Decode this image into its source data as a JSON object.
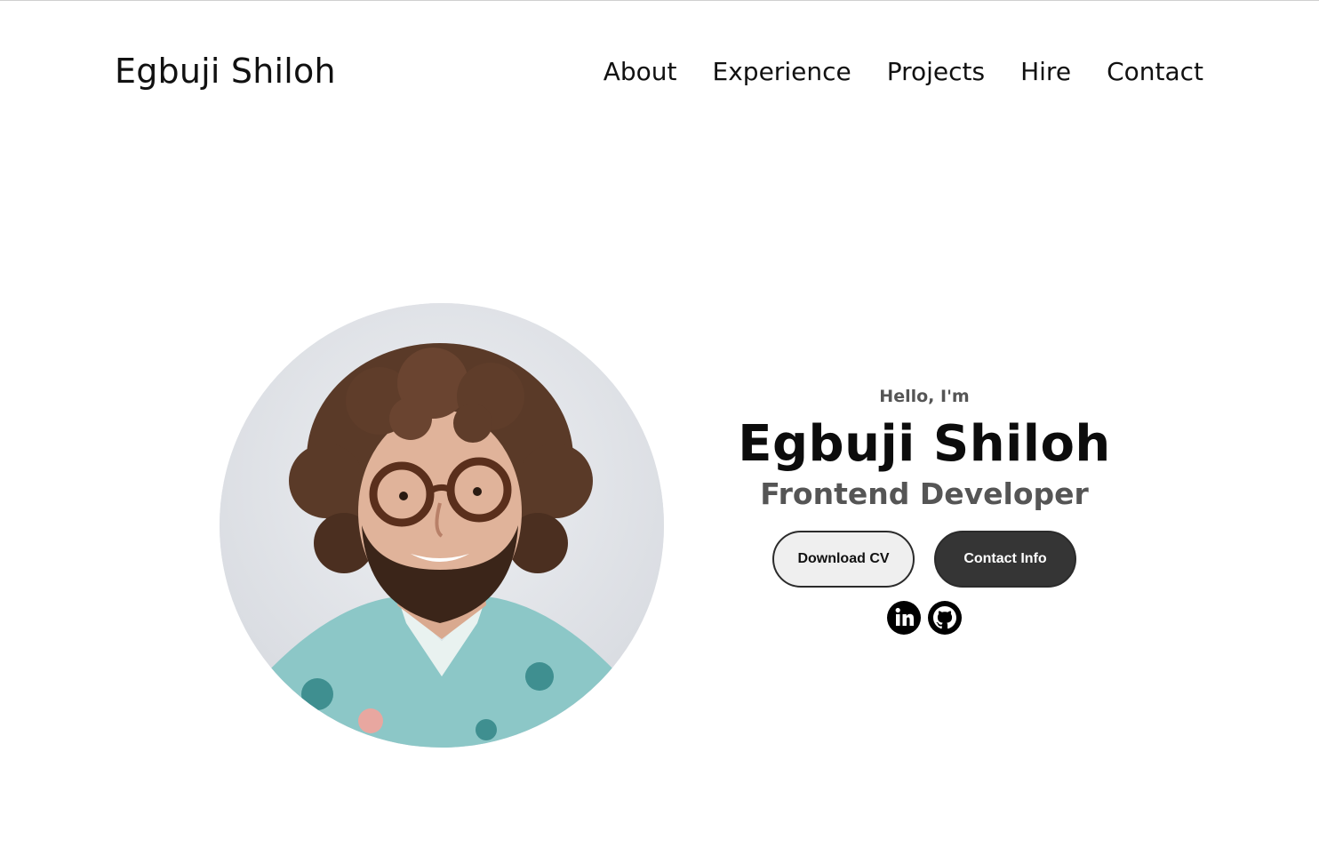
{
  "header": {
    "logo": "Egbuji Shiloh",
    "nav": [
      "About",
      "Experience",
      "Projects",
      "Hire",
      "Contact"
    ]
  },
  "hero": {
    "greeting": "Hello, I'm",
    "name": "Egbuji Shiloh",
    "role": "Frontend Developer",
    "buttons": {
      "download_cv": "Download CV",
      "contact_info": "Contact Info"
    },
    "social_icons": [
      "linkedin-icon",
      "github-icon"
    ]
  },
  "colors": {
    "background": "#ffffff",
    "text": "#111111",
    "muted_text": "#555555",
    "button_dark": "#353535",
    "button_light": "#efefef"
  }
}
